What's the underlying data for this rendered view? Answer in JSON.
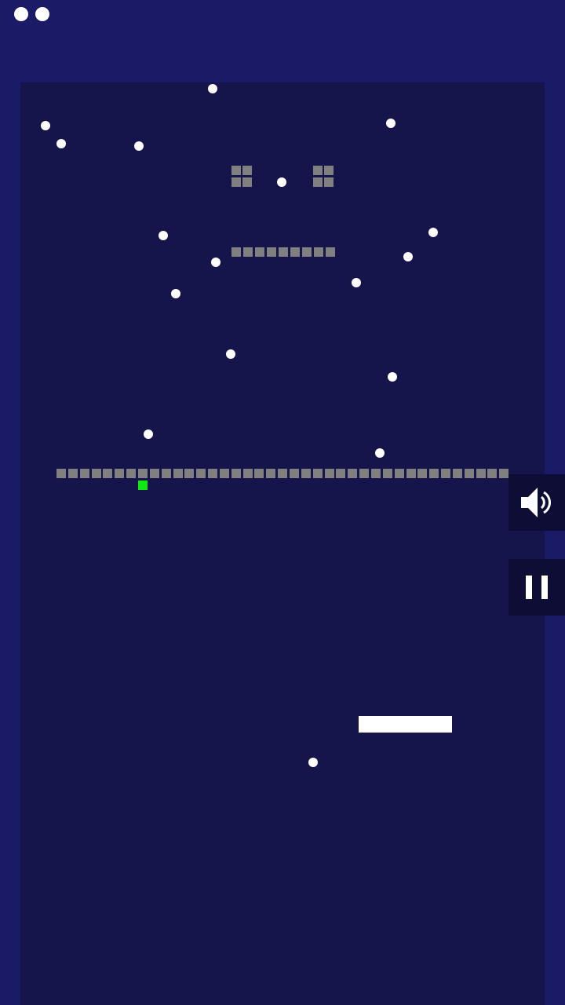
{
  "game": {
    "lives": 2,
    "colors": {
      "background": "#1b1a66",
      "field": "#16154b",
      "ball": "#ffffff",
      "brick": "#808080",
      "special_brick": "#11e811",
      "paddle": "#ffffff",
      "button_bg": "#0d0d36"
    },
    "controls": {
      "sound_icon": "speaker-icon",
      "pause_icon": "pause-icon"
    }
  }
}
